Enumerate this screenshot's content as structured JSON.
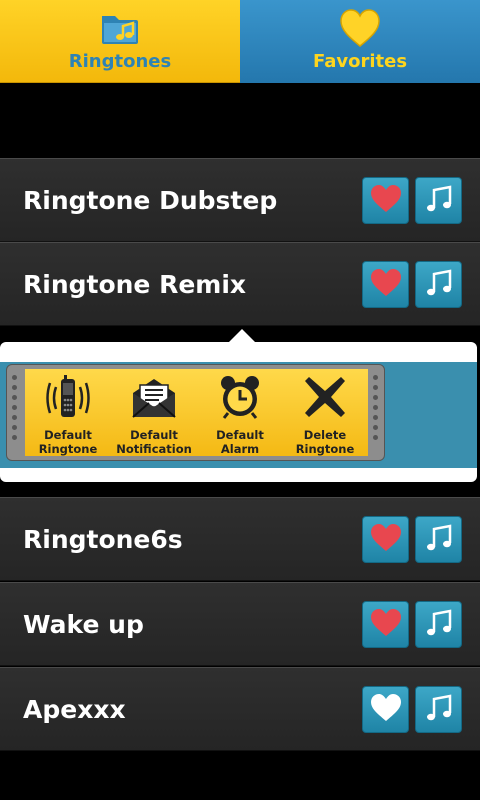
{
  "tabs": [
    {
      "label": "Ringtones",
      "icon": "music-folder-icon",
      "active": true
    },
    {
      "label": "Favorites",
      "icon": "heart-icon",
      "active": false
    }
  ],
  "rows_top": [
    {
      "title": "Ringtone Dubstep",
      "favorite": true
    },
    {
      "title": "Ringtone Remix",
      "favorite": true
    }
  ],
  "popup": {
    "actions": [
      {
        "line1": "Default",
        "line2": "Ringtone",
        "icon": "phone-icon"
      },
      {
        "line1": "Default",
        "line2": "Notification",
        "icon": "envelope-icon"
      },
      {
        "line1": "Default",
        "line2": "Alarm",
        "icon": "alarm-clock-icon"
      },
      {
        "line1": "Delete",
        "line2": "Ringtone",
        "icon": "delete-x-icon"
      }
    ]
  },
  "rows_bottom": [
    {
      "title": "Ringtone6s",
      "favorite": true
    },
    {
      "title": "Wake up",
      "favorite": true
    },
    {
      "title": "Apexxx",
      "favorite": false
    }
  ],
  "colors": {
    "accent_yellow": "#ffd327",
    "accent_blue": "#2e83b4",
    "heart_red": "#e8474f",
    "heart_white": "#ffffff"
  }
}
